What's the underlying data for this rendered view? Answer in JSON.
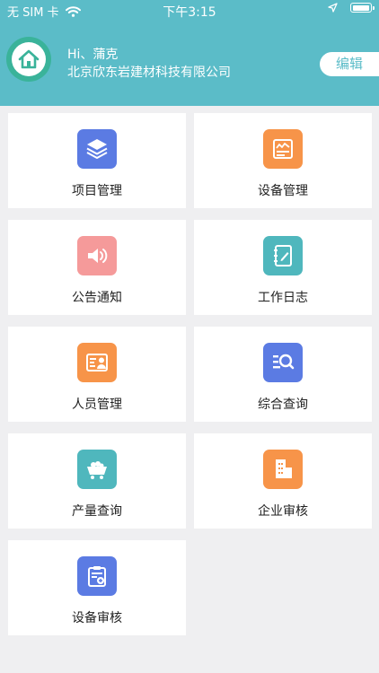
{
  "status_bar": {
    "carrier": "无 SIM 卡",
    "time": "下午3:15",
    "battery_level": 1.0
  },
  "user": {
    "greeting": "Hi、蒲克",
    "company": "北京欣东岩建材科技有限公司"
  },
  "header": {
    "edit_label": "编辑"
  },
  "colors": {
    "header_bg": "#5bbcc8",
    "blue": "#5b7be3",
    "orange": "#f79449",
    "pink": "#f59a9a",
    "teal": "#4fb7bd"
  },
  "menu": {
    "items": [
      {
        "label": "项目管理",
        "icon": "layers-icon",
        "color": "#5b7be3"
      },
      {
        "label": "设备管理",
        "icon": "monitor-icon",
        "color": "#f79449"
      },
      {
        "label": "公告通知",
        "icon": "speaker-icon",
        "color": "#f59a9a"
      },
      {
        "label": "工作日志",
        "icon": "notebook-icon",
        "color": "#4fb7bd"
      },
      {
        "label": "人员管理",
        "icon": "id-card-icon",
        "color": "#f79449"
      },
      {
        "label": "综合查询",
        "icon": "search-list-icon",
        "color": "#5b7be3"
      },
      {
        "label": "产量查询",
        "icon": "cart-icon",
        "color": "#4fb7bd"
      },
      {
        "label": "企业审核",
        "icon": "building-icon",
        "color": "#f79449"
      },
      {
        "label": "设备审核",
        "icon": "clipboard-icon",
        "color": "#5b7be3"
      }
    ]
  }
}
